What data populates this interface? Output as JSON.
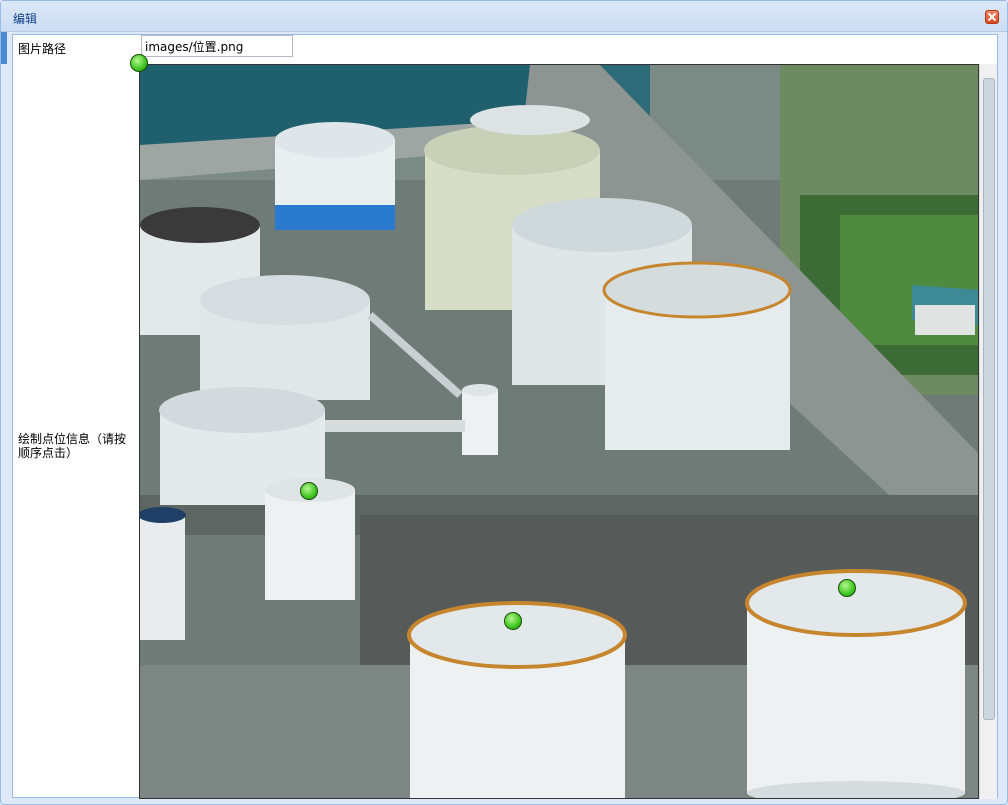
{
  "window": {
    "title": "编辑"
  },
  "form": {
    "image_path_label": "图片路径",
    "image_path_value": "images/位置.png",
    "draw_points_label": "绘制点位信息（请按顺序点击）"
  },
  "image": {
    "description_icon": "industrial-tank-farm-photo"
  },
  "markers": [
    {
      "name": "point-1"
    },
    {
      "name": "point-2"
    },
    {
      "name": "point-3"
    },
    {
      "name": "point-4"
    }
  ],
  "colors": {
    "title_text": "#15428b",
    "border": "#99bbe8",
    "marker": "#3ec71f"
  }
}
